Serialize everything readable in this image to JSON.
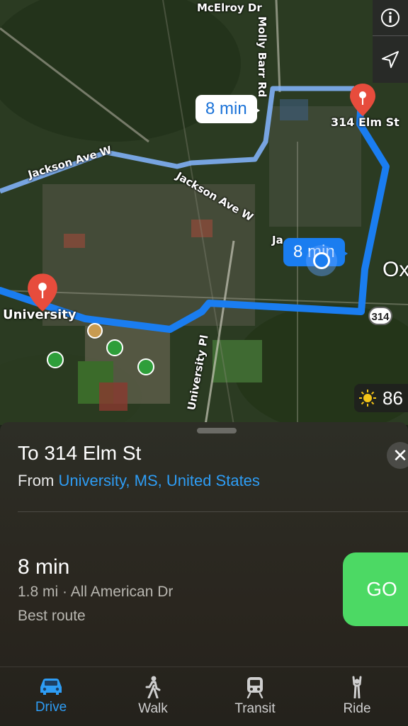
{
  "map": {
    "roads": {
      "mcelroy": "McElroy Dr",
      "molly_barr": "Molly Barr Rd",
      "jackson_1": "Jackson Ave W",
      "jackson_2": "Jackson Ave W",
      "jackson_partial": "Ja",
      "university_pl": "University Pl"
    },
    "places": {
      "destination": "314 Elm St",
      "origin": "University",
      "city_partial": "Ox"
    },
    "route_bubbles": {
      "alternate": "8 min",
      "primary": "8 min"
    },
    "highway_shield": "314",
    "weather_temp": "86",
    "icons": {
      "info": "info-icon",
      "location": "location-arrow-icon",
      "sun": "sun-icon"
    },
    "colors": {
      "route_primary": "#1a7df0",
      "route_alternate": "#7fb0f5",
      "pin": "#e74c3c"
    }
  },
  "sheet": {
    "title": "To 314 Elm St",
    "from_prefix": "From ",
    "from_value": "University, MS, United States",
    "close_symbol": "✕",
    "route": {
      "time": "8 min",
      "detail": "1.8 mi · All American Dr",
      "note": "Best route"
    },
    "go_label": "GO"
  },
  "tabs": [
    {
      "label": "Drive",
      "icon": "car-icon",
      "active": true
    },
    {
      "label": "Walk",
      "icon": "walk-icon",
      "active": false
    },
    {
      "label": "Transit",
      "icon": "train-icon",
      "active": false
    },
    {
      "label": "Ride",
      "icon": "hail-icon",
      "active": false
    }
  ],
  "colors": {
    "accent": "#2e9df5",
    "go_button": "#4cd964"
  }
}
